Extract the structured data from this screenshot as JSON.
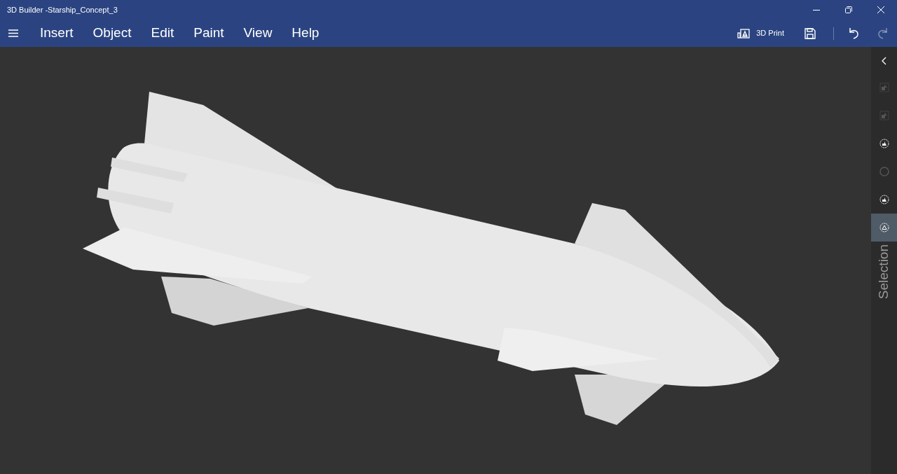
{
  "window": {
    "title": "3D Builder -Starship_Concept_3"
  },
  "menu": [
    "Insert",
    "Object",
    "Edit",
    "Paint",
    "View",
    "Help"
  ],
  "toolbar": {
    "print_label": "3D Print",
    "undo_disabled": false,
    "redo_disabled": true
  },
  "side_panel": {
    "label": "Selection",
    "tools": [
      {
        "kind": "frame",
        "disabled": true,
        "selected": false
      },
      {
        "kind": "frame",
        "disabled": true,
        "selected": false
      },
      {
        "kind": "ring-shapes",
        "disabled": false,
        "selected": false
      },
      {
        "kind": "ring",
        "disabled": true,
        "selected": false
      },
      {
        "kind": "ring-shapes",
        "disabled": false,
        "selected": false
      },
      {
        "kind": "ring-triangle",
        "disabled": false,
        "selected": true
      }
    ]
  }
}
